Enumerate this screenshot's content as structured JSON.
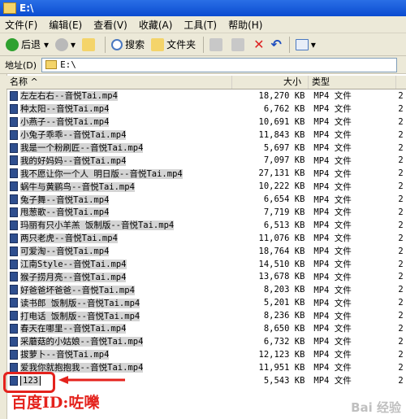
{
  "window": {
    "title": "E:\\"
  },
  "menu": [
    "文件(F)",
    "编辑(E)",
    "查看(V)",
    "收藏(A)",
    "工具(T)",
    "帮助(H)"
  ],
  "toolbar": {
    "back": "后退",
    "search": "搜索",
    "folders": "文件夹"
  },
  "address": {
    "label": "地址(D)",
    "value": "E:\\"
  },
  "columns": {
    "name": "名称",
    "size": "大小",
    "type": "类型"
  },
  "files": [
    {
      "name": "左左右右--音悦Tai.mp4",
      "size": "18,270 KB",
      "type": "MP4 文件"
    },
    {
      "name": "种太阳--音悦Tai.mp4",
      "size": "6,762 KB",
      "type": "MP4 文件"
    },
    {
      "name": "小燕子--音悦Tai.mp4",
      "size": "10,691 KB",
      "type": "MP4 文件"
    },
    {
      "name": "小兔子乖乖--音悦Tai.mp4",
      "size": "11,843 KB",
      "type": "MP4 文件"
    },
    {
      "name": "我是一个粉刷匠--音悦Tai.mp4",
      "size": "5,697 KB",
      "type": "MP4 文件"
    },
    {
      "name": "我的好妈妈--音悦Tai.mp4",
      "size": "7,097 KB",
      "type": "MP4 文件"
    },
    {
      "name": "我不愿让你一个人 明日版--音悦Tai.mp4",
      "size": "27,131 KB",
      "type": "MP4 文件"
    },
    {
      "name": "蜗牛与黄鹂鸟--音悦Tai.mp4",
      "size": "10,222 KB",
      "type": "MP4 文件"
    },
    {
      "name": "兔子舞--音悦Tai.mp4",
      "size": "6,654 KB",
      "type": "MP4 文件"
    },
    {
      "name": "甩葱歌--音悦Tai.mp4",
      "size": "7,719 KB",
      "type": "MP4 文件"
    },
    {
      "name": "玛丽有只小羊羔 饭制版--音悦Tai.mp4",
      "size": "6,513 KB",
      "type": "MP4 文件"
    },
    {
      "name": "两只老虎--音悦Tai.mp4",
      "size": "11,076 KB",
      "type": "MP4 文件"
    },
    {
      "name": "可爱淘--音悦Tai.mp4",
      "size": "18,764 KB",
      "type": "MP4 文件"
    },
    {
      "name": "江南Style--音悦Tai.mp4",
      "size": "14,510 KB",
      "type": "MP4 文件"
    },
    {
      "name": "猴子捞月亮--音悦Tai.mp4",
      "size": "13,678 KB",
      "type": "MP4 文件"
    },
    {
      "name": "好爸爸坏爸爸--音悦Tai.mp4",
      "size": "8,203 KB",
      "type": "MP4 文件"
    },
    {
      "name": "读书郎 饭制版--音悦Tai.mp4",
      "size": "5,201 KB",
      "type": "MP4 文件"
    },
    {
      "name": "打电话 饭制版--音悦Tai.mp4",
      "size": "8,236 KB",
      "type": "MP4 文件"
    },
    {
      "name": "春天在哪里--音悦Tai.mp4",
      "size": "8,650 KB",
      "type": "MP4 文件"
    },
    {
      "name": "采蘑菇的小姑娘--音悦Tai.mp4",
      "size": "6,732 KB",
      "type": "MP4 文件"
    },
    {
      "name": "拔萝卜--音悦Tai.mp4",
      "size": "12,123 KB",
      "type": "MP4 文件"
    },
    {
      "name": "爱我你就抱抱我--音悦Tai.mp4",
      "size": "11,951 KB",
      "type": "MP4 文件"
    },
    {
      "name": "123",
      "size": "5,543 KB",
      "type": "MP4 文件"
    }
  ],
  "extra_col_glyph": "2",
  "annotation": {
    "caption": "百度ID:咗嚛",
    "color": "#e4221c"
  },
  "watermark": "Bai 经验"
}
